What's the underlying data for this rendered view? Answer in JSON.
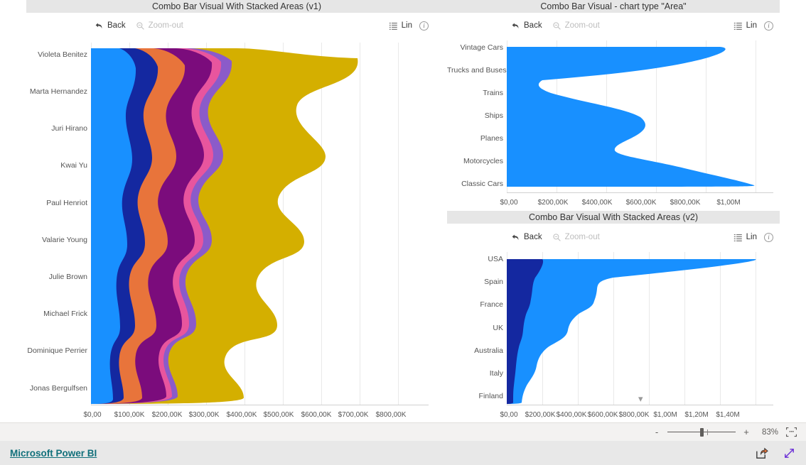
{
  "app": {
    "brand": "Microsoft Power BI"
  },
  "statusbar": {
    "zoom_out_label": "-",
    "zoom_in_label": "+",
    "zoom_percent": "83%",
    "fit_icon": "fit-to-page-icon"
  },
  "footer": {
    "share_icon": "share-icon",
    "fullscreen_icon": "fullscreen-icon"
  },
  "toolbar": {
    "back_label": "Back",
    "zoomout_label": "Zoom-out",
    "lin_label": "Lin",
    "back_icon": "back-arrow-icon",
    "zoomout_icon": "magnifier-minus-icon",
    "legend_icon": "legend-list-icon",
    "info_icon": "info-circle-icon"
  },
  "panels": [
    {
      "id": "v1",
      "title": "Combo Bar Visual With Stacked Areas (v1)"
    },
    {
      "id": "area",
      "title": "Combo Bar Visual - chart type \"Area\""
    },
    {
      "id": "v2",
      "title": "Combo Bar Visual With Stacked Areas (v2)"
    }
  ],
  "chart_data": [
    {
      "id": "v1",
      "type": "area",
      "orientation": "horizontal",
      "title": "Combo Bar Visual With Stacked Areas (v1)",
      "stacked": true,
      "xlabel": "",
      "ylabel": "",
      "grid": true,
      "legend_position": "hidden",
      "xlim": [
        0,
        880000
      ],
      "xticks": [
        0,
        100000,
        200000,
        300000,
        400000,
        500000,
        600000,
        700000,
        800000
      ],
      "xticklabels": [
        "$0,00",
        "$100,00K",
        "$200,00K",
        "$300,00K",
        "$400,00K",
        "$500,00K",
        "$600,00K",
        "$700,00K",
        "$800,00K"
      ],
      "categories": [
        "Violeta Benitez",
        "Marta Hernandez",
        "Juri Hirano",
        "Kwai Yu",
        "Paul Henriot",
        "Valarie Young",
        "Julie Brown",
        "Michael Frick",
        "Dominique Perrier",
        "Jonas Bergulfsen"
      ],
      "series": [
        {
          "name": "Series 1",
          "color": "#1890ff",
          "values": [
            116000,
            112000,
            104000,
            97000,
            92000,
            88000,
            84000,
            80000,
            74000,
            66000
          ]
        },
        {
          "name": "Series 2",
          "color": "#1428a0",
          "values": [
            52000,
            58000,
            66000,
            58000,
            44000,
            36000,
            32000,
            26000,
            22000,
            16000
          ]
        },
        {
          "name": "Series 3",
          "color": "#e8743b",
          "values": [
            66000,
            74000,
            68000,
            60000,
            66000,
            58000,
            44000,
            32000,
            26000,
            14000
          ]
        },
        {
          "name": "Series 4",
          "color": "#7b0c7c",
          "values": [
            60000,
            46000,
            56000,
            68000,
            56000,
            48000,
            36000,
            22000,
            12000,
            8000
          ]
        },
        {
          "name": "Series 5",
          "color": "#e8559e",
          "values": [
            18000,
            14000,
            12000,
            14000,
            10000,
            9000,
            8000,
            6000,
            5000,
            3000
          ]
        },
        {
          "name": "Series 6",
          "color": "#8b5bc9",
          "values": [
            26000,
            22000,
            18000,
            22000,
            18000,
            13000,
            10000,
            8000,
            7000,
            5000
          ]
        },
        {
          "name": "Series 7",
          "color": "#d4af00",
          "values": [
            442000,
            316000,
            258000,
            262000,
            222000,
            192000,
            166000,
            116000,
            84000,
            52000
          ]
        }
      ]
    },
    {
      "id": "area",
      "type": "area",
      "orientation": "horizontal",
      "title": "Combo Bar Visual - chart type \"Area\"",
      "stacked": false,
      "xlabel": "",
      "ylabel": "",
      "grid": true,
      "legend_position": "hidden",
      "xlim": [
        0,
        1060000
      ],
      "xticks": [
        0,
        200000,
        400000,
        600000,
        800000,
        1000000
      ],
      "xticklabels": [
        "$0,00",
        "$200,00K",
        "$400,00K",
        "$600,00K",
        "$800,00K",
        "$1,00M"
      ],
      "categories": [
        "Vintage Cars",
        "Trucks and Buses",
        "Trains",
        "Ships",
        "Planes",
        "Motorcycles",
        "Classic Cars"
      ],
      "series": [
        {
          "name": "Sales",
          "color": "#1890ff",
          "values": [
            920000,
            560000,
            130000,
            370000,
            490000,
            330000,
            1000000
          ]
        }
      ]
    },
    {
      "id": "v2",
      "type": "area",
      "orientation": "horizontal",
      "title": "Combo Bar Visual With Stacked Areas (v2)",
      "stacked": true,
      "xlabel": "",
      "ylabel": "",
      "grid": true,
      "legend_position": "hidden",
      "xlim": [
        0,
        1500000
      ],
      "xticks": [
        0,
        200000,
        400000,
        600000,
        800000,
        1000000,
        1200000,
        1400000
      ],
      "xticklabels": [
        "$0,00",
        "$200,00K",
        "$400,00K",
        "$600,00K",
        "$800,00K",
        "$1,00M",
        "$1,20M",
        "$1,40M"
      ],
      "categories": [
        "USA",
        "Spain",
        "France",
        "UK",
        "Australia",
        "Italy",
        "Finland"
      ],
      "series": [
        {
          "name": "Series 1",
          "color": "#1428a0",
          "values": [
            200000,
            150000,
            120000,
            95000,
            80000,
            62000,
            42000
          ]
        },
        {
          "name": "Series 2",
          "color": "#1890ff",
          "values": [
            1225000,
            455000,
            400000,
            300000,
            200000,
            145000,
            58000
          ]
        }
      ],
      "scroll_indicator": "chevron-down-icon"
    }
  ]
}
